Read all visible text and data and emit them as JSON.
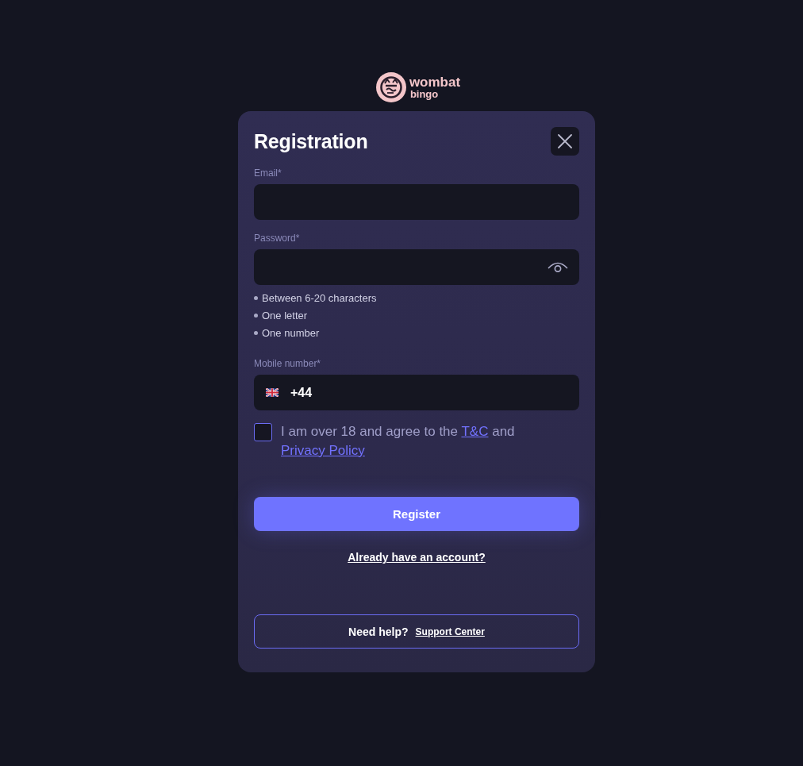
{
  "logo": {
    "wordmark": "wombat",
    "tagline": "bingo"
  },
  "dialog": {
    "title": "Registration",
    "fields": [
      {
        "kind": "email",
        "label": "Email*"
      },
      {
        "kind": "password",
        "label": "Password*",
        "hints": [
          "Between 6-20 characters",
          "One letter",
          "One number"
        ]
      },
      {
        "kind": "phone",
        "label": "Mobile number*",
        "country_code": "+44"
      }
    ],
    "consent": {
      "checked": false,
      "parts": [
        {
          "kind": "text",
          "text": "I am over 18 and agree to the"
        },
        {
          "kind": "link",
          "text": "T&C"
        },
        {
          "kind": "text",
          "text": "and"
        },
        {
          "kind": "link",
          "text": "Privacy Policy"
        }
      ]
    },
    "submit": "Register",
    "login_link": "Already have an account?",
    "help": {
      "text": "Need help?",
      "link": "Support Center"
    }
  }
}
